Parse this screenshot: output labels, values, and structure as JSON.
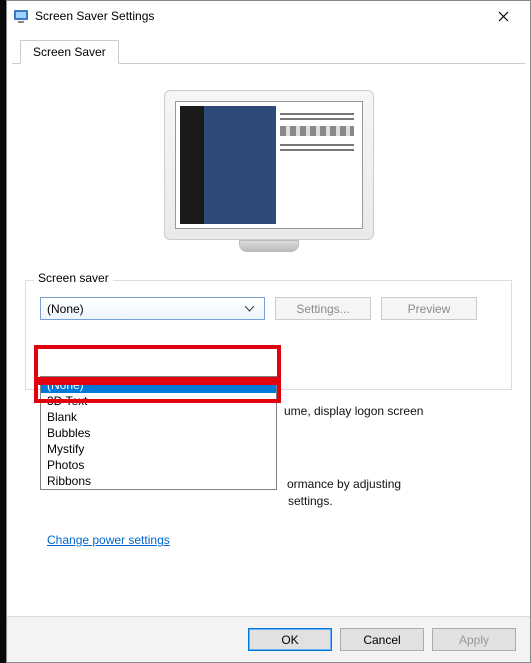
{
  "window": {
    "title": "Screen Saver Settings"
  },
  "tab": {
    "label": "Screen Saver"
  },
  "group": {
    "legend": "Screen saver"
  },
  "dropdown": {
    "selected": "(None)",
    "options": [
      "(None)",
      "3D Text",
      "Blank",
      "Bubbles",
      "Mystify",
      "Photos",
      "Ribbons"
    ]
  },
  "buttons": {
    "settings": "Settings...",
    "preview": "Preview",
    "ok": "OK",
    "cancel": "Cancel",
    "apply": "Apply"
  },
  "fragments": {
    "resume_tail": "ume, display logon screen",
    "power_tail_1": "ormance by adjusting",
    "power_tail_2": " settings."
  },
  "link": {
    "power": "Change power settings"
  }
}
